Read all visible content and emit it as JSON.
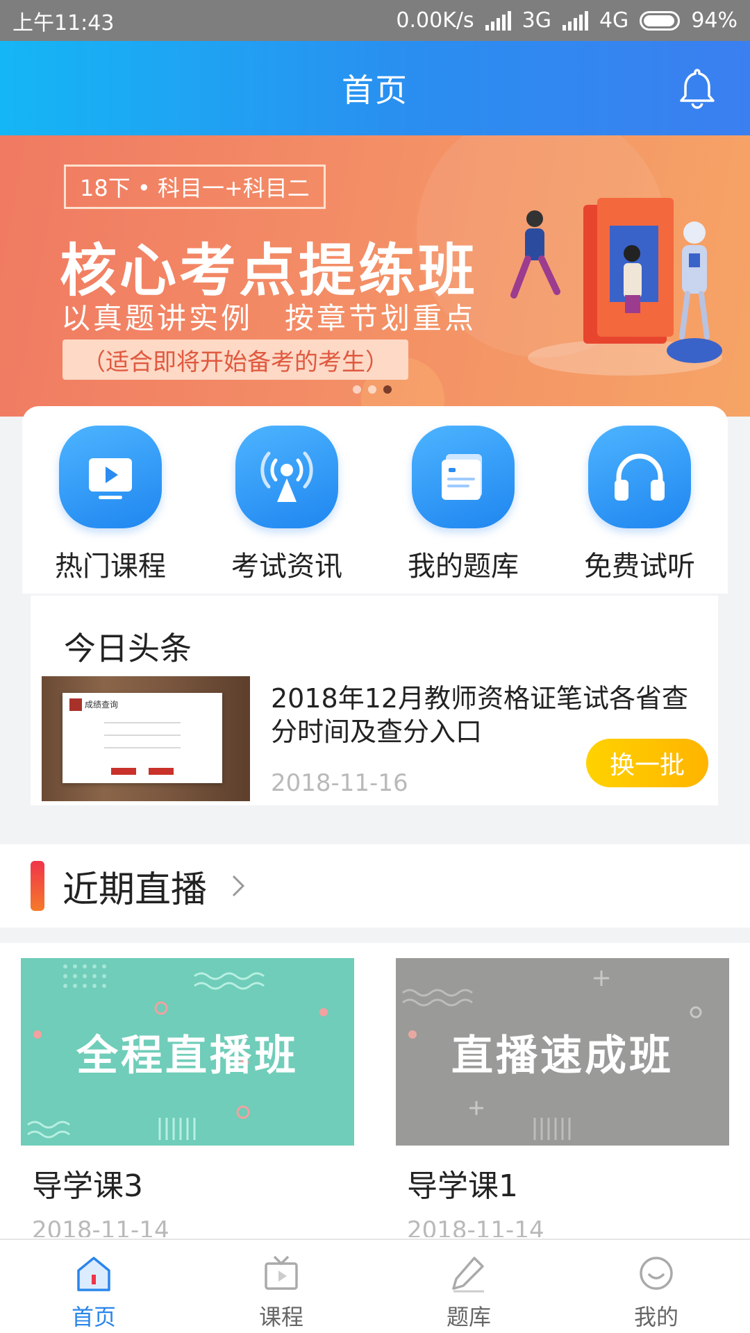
{
  "status_bar": {
    "time": "上午11:43",
    "net_speed": "0.00K/s",
    "network_3g": "3G",
    "network_4g": "4G",
    "battery": "94%",
    "battery_level": 0.94
  },
  "header": {
    "title": "首页",
    "bell_icon": "bell-icon"
  },
  "banner": {
    "tag": "18下 • 科目一+科目二",
    "headline": "核心考点提练班",
    "subline": "以真题讲实例　按章节划重点",
    "pill": "（适合即将开始备考的考生）",
    "active_dot": 3,
    "dot_count": 3
  },
  "quick_entries": [
    {
      "label": "热门课程",
      "icon": "play-video-icon"
    },
    {
      "label": "考试资讯",
      "icon": "broadcast-icon"
    },
    {
      "label": "我的题库",
      "icon": "document-icon"
    },
    {
      "label": "免费试听",
      "icon": "headphones-icon"
    }
  ],
  "news": {
    "section_title": "今日头条",
    "headline": "2018年12月教师资格证笔试各省查分时间及查分入口",
    "date": "2018-11-16",
    "swap_button": "换一批",
    "thumb_title": "成绩查询"
  },
  "live_section": {
    "title": "近期直播",
    "cards": [
      {
        "cover_text": "全程直播班",
        "title": "导学课3",
        "date": "2018-11-14",
        "cover_color": "#6fcdb9"
      },
      {
        "cover_text": "直播速成班",
        "title": "导学课1",
        "date": "2018-11-14",
        "cover_color": "#9a9a98"
      }
    ]
  },
  "tabbar": {
    "items": [
      {
        "label": "首页",
        "icon": "home-icon",
        "active": true
      },
      {
        "label": "课程",
        "icon": "tv-icon",
        "active": false
      },
      {
        "label": "题库",
        "icon": "pencil-icon",
        "active": false
      },
      {
        "label": "我的",
        "icon": "user-face-icon",
        "active": false
      }
    ],
    "active_color": "#2a86ea"
  }
}
